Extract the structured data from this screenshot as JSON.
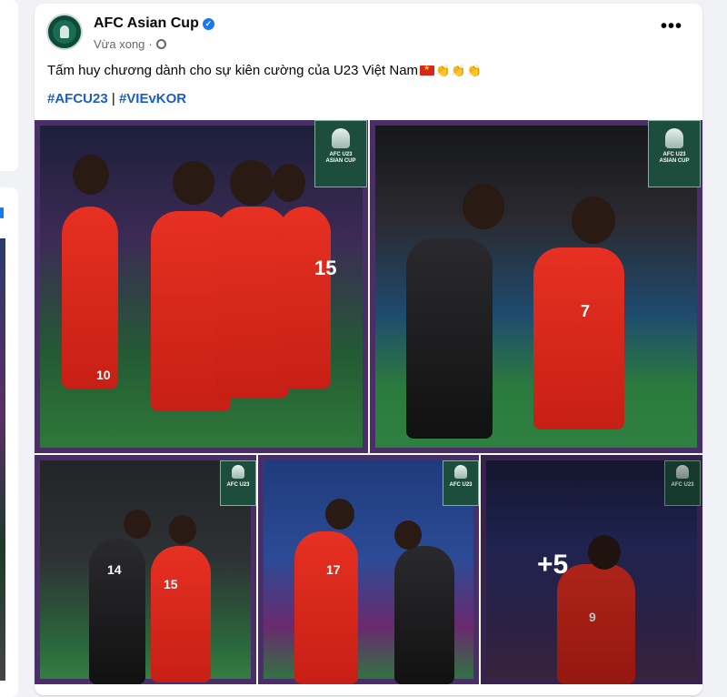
{
  "post": {
    "page_name": "AFC Asian Cup",
    "timestamp": "Vừa xong",
    "caption": "Tấm huy chương dành cho sự kiên cường của U23 Việt Nam",
    "hashtag_1": "#AFCU23",
    "separator": "|",
    "hashtag_2": "#VIEvKOR",
    "more_label": "•••"
  },
  "photos": {
    "badge_line1": "AFC U23",
    "badge_line2": "ASIAN CUP",
    "numbers": {
      "p1_a": "10",
      "p1_b": "15",
      "p2_a": "7",
      "p3_a": "14",
      "p3_b": "15",
      "p4_a": "17",
      "p5_a": "9"
    },
    "more_count": "+5"
  },
  "colors": {
    "hashtag": "#1a5ec9",
    "verified": "#1877f2",
    "vietnam_red": "#e63022",
    "korea_black": "#1a1a1d"
  },
  "icons": [
    "verified-icon",
    "privacy-gear-icon",
    "more-options-icon",
    "flag-vn-icon",
    "clap-icon"
  ]
}
